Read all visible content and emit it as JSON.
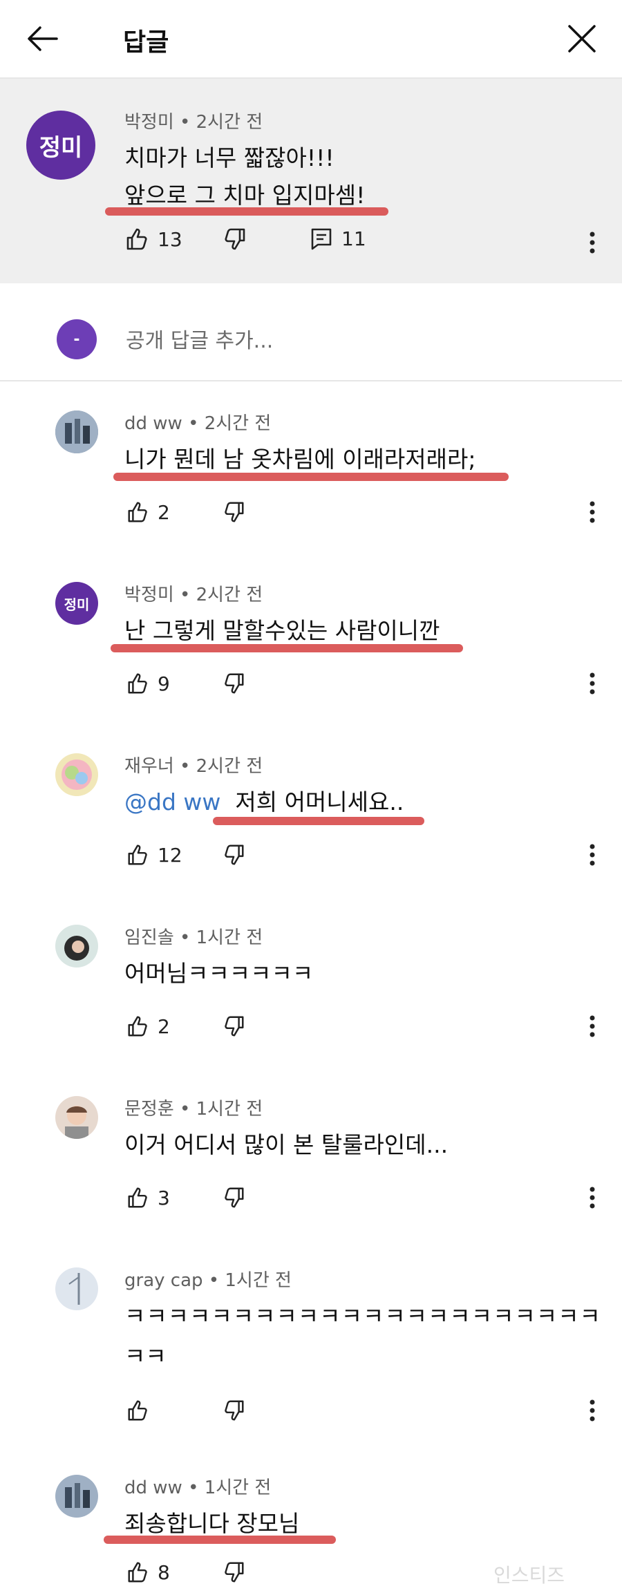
{
  "header": {
    "title": "답글"
  },
  "parent": {
    "avatar_text": "정미",
    "author": "박정미",
    "time": "2시간 전",
    "lines": [
      "치마가 너무 짧잖아!!!",
      "앞으로 그 치마 입지마셈!"
    ],
    "likes": "13",
    "replies": "11"
  },
  "reply_input": {
    "placeholder": "공개 답글 추가..."
  },
  "comments": [
    {
      "author": "dd ww",
      "time": "2시간 전",
      "text": "니가 뭔데 남 옷차림에 이래라저래라;",
      "likes": "2"
    },
    {
      "author": "박정미",
      "time": "2시간 전",
      "avatar_text": "정미",
      "text": "난 그렇게 말할수있는 사람이니깐",
      "likes": "9"
    },
    {
      "author": "재우너",
      "time": "2시간 전",
      "mention": "@dd ww",
      "text": "저희 어머니세요..",
      "likes": "12"
    },
    {
      "author": "임진솔",
      "time": "1시간 전",
      "text": "어머님ㅋㅋㅋㅋㅋㅋ",
      "likes": "2"
    },
    {
      "author": "문정훈",
      "time": "1시간 전",
      "text": "이거 어디서 많이 본 탈룰라인데...",
      "likes": "3"
    },
    {
      "author": "gray cap",
      "time": "1시간 전",
      "text": "ㅋㅋㅋㅋㅋㅋㅋㅋㅋㅋㅋㅋㅋㅋㅋㅋㅋㅋㅋㅋㅋㅋ",
      "text2": "ㅋㅋ",
      "likes": ""
    },
    {
      "author": "dd ww",
      "time": "1시간 전",
      "text": "죄송합니다 장모님",
      "likes": "8"
    }
  ],
  "watermark": "인스티즈",
  "colors": {
    "underline": "#d74a4a",
    "mention": "#3a76c4",
    "parent_bg": "#efefef",
    "avatar_purple": "#5f2ea0"
  },
  "icons": [
    "back-arrow-icon",
    "close-icon",
    "thumb-up-icon",
    "thumb-down-icon",
    "reply-icon",
    "more-vert-icon"
  ]
}
